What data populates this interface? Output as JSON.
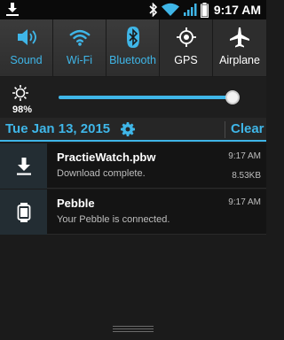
{
  "status_bar": {
    "time": "9:17 AM",
    "icons": [
      "download-icon",
      "bluetooth-icon",
      "wifi-icon",
      "signal-icon",
      "battery-icon"
    ]
  },
  "quick_settings": {
    "tiles": [
      {
        "label": "Sound",
        "icon": "volume-icon",
        "active": true
      },
      {
        "label": "Wi-Fi",
        "icon": "wifi-icon",
        "active": true
      },
      {
        "label": "Bluetooth",
        "icon": "bluetooth-icon",
        "active": true
      },
      {
        "label": "GPS",
        "icon": "gps-icon",
        "active": false
      },
      {
        "label": "Airplane",
        "icon": "airplane-icon",
        "active": false
      }
    ]
  },
  "brightness": {
    "percent_label": "98%",
    "value": 0.98
  },
  "date_bar": {
    "date": "Tue Jan 13, 2015",
    "clear_label": "Clear"
  },
  "notifications": [
    {
      "title": "PractieWatch.pbw",
      "text": "Download complete.",
      "time": "9:17 AM",
      "size": "8.53KB",
      "icon": "download-icon"
    },
    {
      "title": "Pebble",
      "text": "Your Pebble is connected.",
      "time": "9:17 AM",
      "icon": "watch-icon"
    }
  ],
  "colors": {
    "accent": "#3fb6e8",
    "background": "#1b1b1b"
  }
}
